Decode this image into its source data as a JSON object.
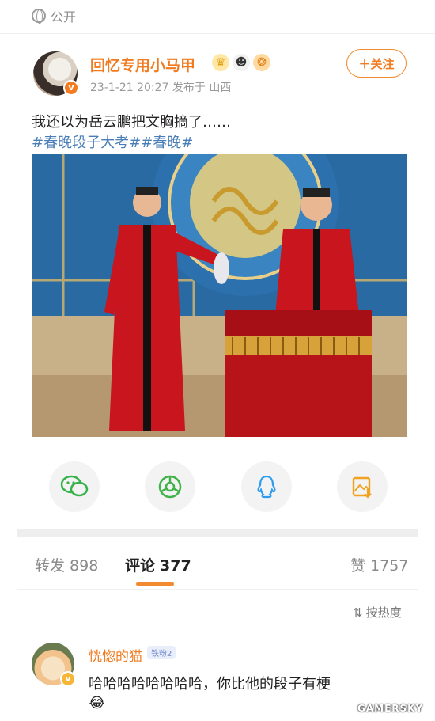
{
  "status": {
    "visibility": "公开",
    "globe_icon": "globe-icon"
  },
  "post": {
    "username": "回忆专用小马甲",
    "badges": [
      "crown-icon",
      "panda-icon",
      "lion-icon"
    ],
    "meta": "23-1-21 20:27  发布于 山西",
    "follow_label": "＋关注",
    "text": "我还以为岳云鹏把文胸摘了……",
    "hashtags": "#春晚段子大考##春晚#"
  },
  "share": {
    "items": [
      {
        "name": "wechat-icon",
        "glyph": "◎",
        "color": "#35b24a"
      },
      {
        "name": "moments-icon",
        "glyph": "✺",
        "color": "#41b34a"
      },
      {
        "name": "qq-icon",
        "glyph": "♙",
        "color": "#2b9cf0"
      },
      {
        "name": "image-save-icon",
        "glyph": "▣",
        "color": "#f1a21f"
      }
    ]
  },
  "tabs": {
    "repost": {
      "label": "转发",
      "count": "898"
    },
    "comments": {
      "label": "评论",
      "count": "377"
    },
    "likes": {
      "label": "赞",
      "count": "1757"
    }
  },
  "sort": {
    "label": "按热度",
    "icon": "sort-icon"
  },
  "comment": {
    "name": "恍惚的猫",
    "level": "铁粉2",
    "text": "哈哈哈哈哈哈哈哈，你比他的段子有梗",
    "emoji": "😂"
  },
  "watermark": "GAMERSKY",
  "accent": "#f07b21"
}
